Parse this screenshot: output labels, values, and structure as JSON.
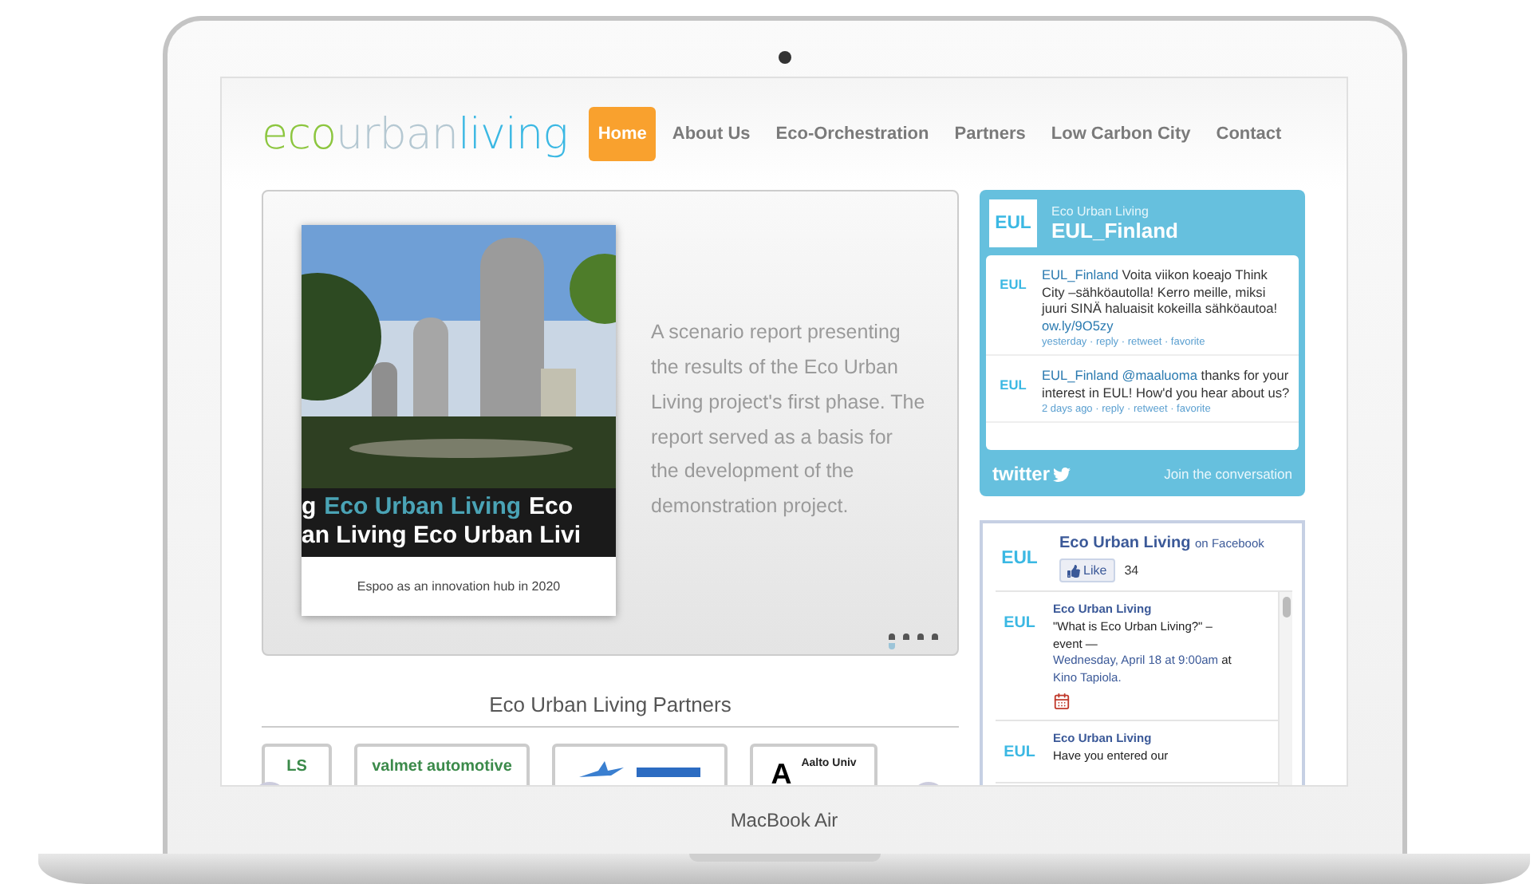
{
  "laptop": {
    "brand_label": "MacBook Air"
  },
  "logo": [
    {
      "text": "eco",
      "color": "#8cc63f"
    },
    {
      "text": "urban",
      "color": "#b5c8d2"
    },
    {
      "text": "living",
      "color": "#3bb8e3"
    }
  ],
  "nav": [
    {
      "label": "Home",
      "selected": true
    },
    {
      "label": "About Us",
      "selected": false
    },
    {
      "label": "Eco-Orchestration",
      "selected": false
    },
    {
      "label": "Partners",
      "selected": false
    },
    {
      "label": "Low Carbon City",
      "selected": false
    },
    {
      "label": "Contact",
      "selected": false
    }
  ],
  "slider": {
    "cover": {
      "band_lines": [
        [
          {
            "text": "g",
            "color": "#ffffff"
          },
          {
            "text": "Eco Urban Living",
            "color": "#4aa3b5"
          },
          {
            "text": "Eco",
            "color": "#ffffff"
          }
        ],
        [
          {
            "text": "an Living Eco Urban Livi",
            "color": "#ffffff"
          }
        ]
      ],
      "caption": "Espoo as an innovation hub in 2020"
    },
    "text": "A scenario report presenting the results of the Eco Urban Living project's first phase. The report served as a basis for the development of the demonstration project.",
    "dots": [
      {
        "selected": true
      },
      {
        "selected": false
      },
      {
        "selected": false
      },
      {
        "selected": false
      }
    ]
  },
  "partners": {
    "title": "Eco Urban Living Partners",
    "items": [
      {
        "kind": "text",
        "label": "LS"
      },
      {
        "kind": "text",
        "label": "valmet automotive"
      },
      {
        "kind": "emblem"
      },
      {
        "kind": "aalto",
        "mark": "A",
        "label": "Aalto Univ"
      }
    ]
  },
  "twitter": {
    "avatar": "EUL",
    "account_name": "Eco Urban Living",
    "handle": "EUL_Finland",
    "tweets": [
      {
        "avatar": "EUL",
        "user": "EUL_Finland",
        "text": "Voita viikon koeajo Think City –sähköautolla! Kerro meille, miksi juuri SINÄ haluaisit kokeilla sähköautoa!",
        "link": "ow.ly/9O5zy",
        "meta": "yesterday · reply · retweet · favorite"
      },
      {
        "avatar": "EUL",
        "user": "EUL_Finland",
        "mention": "@maaluoma",
        "text": "thanks for your interest in EUL! How'd you hear about us?",
        "meta": "2 days ago · reply · retweet · favorite"
      }
    ],
    "brand": "twitter",
    "join": "Join the conversation"
  },
  "facebook": {
    "avatar": "EUL",
    "page_name": "Eco Urban Living",
    "suffix": "on Facebook",
    "like": "Like",
    "like_count": "34",
    "posts": [
      {
        "avatar": "EUL",
        "name": "Eco Urban Living",
        "text": "\"What is Eco Urban Living?\" – event —",
        "when": "Wednesday, April 18 at 9:00am",
        "at": "at",
        "place": "Kino Tapiola.",
        "calendar": true
      },
      {
        "avatar": "EUL",
        "name": "Eco Urban Living",
        "text": "Have you entered our",
        "calendar": false
      }
    ]
  }
}
